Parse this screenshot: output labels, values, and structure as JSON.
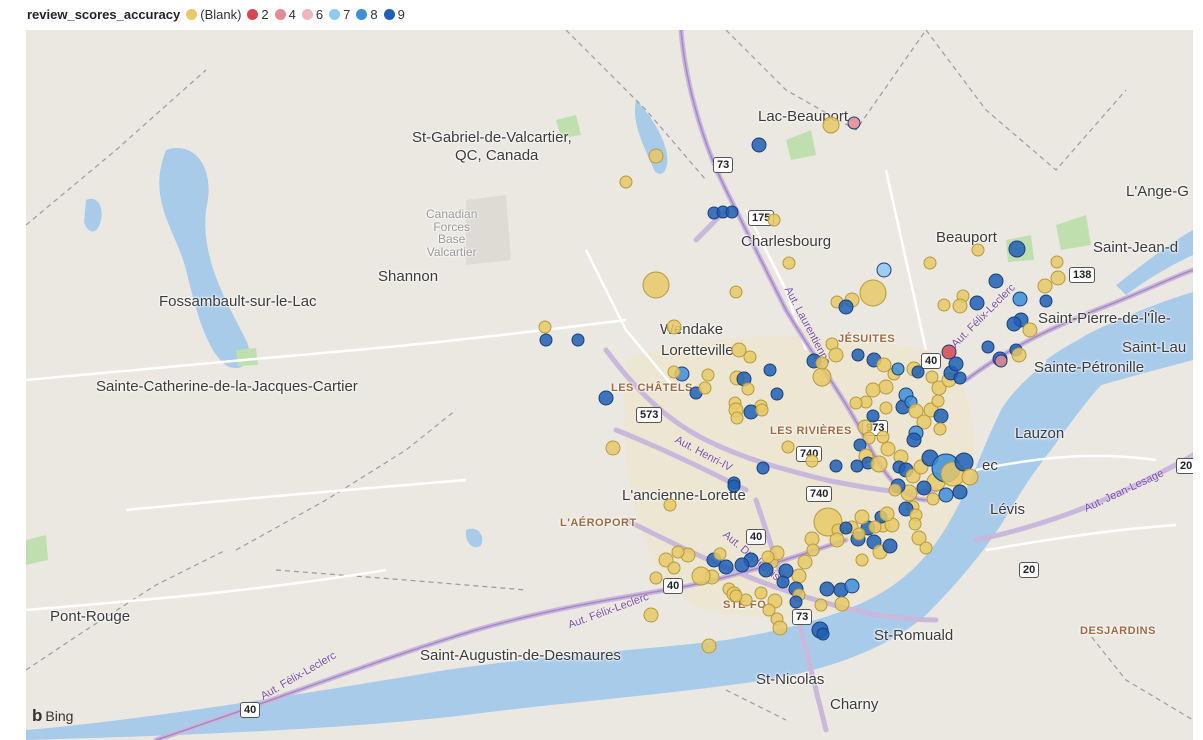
{
  "legend": {
    "title": "review_scores_accuracy",
    "items": [
      {
        "label": "(Blank)",
        "color": "#e8c967"
      },
      {
        "label": "2",
        "color": "#d64550"
      },
      {
        "label": "4",
        "color": "#e48b92"
      },
      {
        "label": "6",
        "color": "#f0b7bb"
      },
      {
        "label": "7",
        "color": "#8fc9f2"
      },
      {
        "label": "8",
        "color": "#3b8ed8"
      },
      {
        "label": "9",
        "color": "#1f5fb5"
      }
    ]
  },
  "places": [
    "Lac-Beauport",
    "St-Gabriel-de-Valcartier,",
    "QC, Canada",
    "L'Ange-G",
    "Charlesbourg",
    "Beauport",
    "Saint-Jean-d",
    "Shannon",
    "Fossambault-sur-le-Lac",
    "Wendake",
    "Loretteville",
    "Saint-Pierre-de-l'Île-",
    "Saint-Lau",
    "Sainte-Pétronille",
    "Sainte-Catherine-de-la-Jacques-Cartier",
    "Lauzon",
    "L'ancienne-Lorette",
    "Lévis",
    "Pont-Rouge",
    "St-Romuald",
    "Saint-Augustin-de-Desmaures",
    "St-Nicolas",
    "Charny",
    "ec"
  ],
  "base_label": [
    "Canadian",
    "Forces",
    "Base",
    "Valcartier"
  ],
  "districts": [
    "JÉSUITES",
    "LES CHÂTELS",
    "LES RIVIÈRES",
    "L'AÉROPORT",
    "DESJARDINS",
    "STE-FO"
  ],
  "routes": [
    "73",
    "175",
    "138",
    "40",
    "573",
    "973",
    "740",
    "740",
    "40",
    "40",
    "73",
    "20",
    "20",
    "40"
  ],
  "highways": [
    "Aut. Laurentienne",
    "Aut. Henri-IV",
    "Aut. Duplessis",
    "Aut. Félix-Leclerc",
    "Aut. Félix-Leclerc",
    "Aut. Jean-Lesage",
    "Aut. Félix-Leclerc"
  ],
  "attribution": {
    "icon": "b",
    "text": "Bing"
  }
}
